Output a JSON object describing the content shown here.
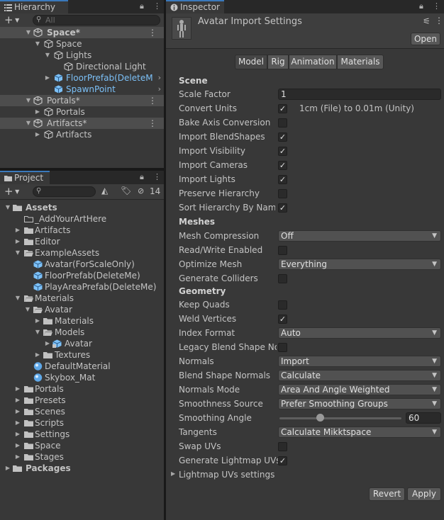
{
  "hierarchy": {
    "title": "Hierarchy",
    "search_placeholder": "All",
    "rows": [
      {
        "label": "Space*",
        "indent": 0
      },
      {
        "label": "Space",
        "indent": 1
      },
      {
        "label": "Lights",
        "indent": 2
      },
      {
        "label": "Directional Light",
        "indent": 3
      },
      {
        "label": "FloorPrefab(DeleteMe)",
        "indent": 2
      },
      {
        "label": "SpawnPoint",
        "indent": 2
      },
      {
        "label": "Portals*",
        "indent": 0
      },
      {
        "label": "Portals",
        "indent": 1
      },
      {
        "label": "Artifacts*",
        "indent": 0
      },
      {
        "label": "Artifacts",
        "indent": 1
      }
    ]
  },
  "project": {
    "title": "Project",
    "search_placeholder": "",
    "hidden_count": "14",
    "rows": [
      {
        "label": "Assets"
      },
      {
        "label": "_AddYourArtHere"
      },
      {
        "label": "Artifacts"
      },
      {
        "label": "Editor"
      },
      {
        "label": "ExampleAssets"
      },
      {
        "label": "Avatar(ForScaleOnly)"
      },
      {
        "label": "FloorPrefab(DeleteMe)"
      },
      {
        "label": "PlayAreaPrefab(DeleteMe)"
      },
      {
        "label": "Materials"
      },
      {
        "label": "Avatar"
      },
      {
        "label": "Materials"
      },
      {
        "label": "Models"
      },
      {
        "label": "Avatar"
      },
      {
        "label": "Textures"
      },
      {
        "label": "DefaultMaterial"
      },
      {
        "label": "Skybox_Mat"
      },
      {
        "label": "Portals"
      },
      {
        "label": "Presets"
      },
      {
        "label": "Scenes"
      },
      {
        "label": "Scripts"
      },
      {
        "label": "Settings"
      },
      {
        "label": "Space"
      },
      {
        "label": "Stages"
      },
      {
        "label": "Packages"
      }
    ]
  },
  "inspector": {
    "title": "Inspector",
    "header_title": "Avatar Import Settings",
    "open_label": "Open",
    "tabs": [
      "Model",
      "Rig",
      "Animation",
      "Materials"
    ],
    "sections": {
      "scene": "Scene",
      "meshes": "Meshes",
      "geometry": "Geometry"
    },
    "labels": {
      "scale_factor": "Scale Factor",
      "convert_units": "Convert Units",
      "bake_axis": "Bake Axis Conversion",
      "import_blendshapes": "Import BlendShapes",
      "import_visibility": "Import Visibility",
      "import_cameras": "Import Cameras",
      "import_lights": "Import Lights",
      "preserve_hierarchy": "Preserve Hierarchy",
      "sort_hierarchy": "Sort Hierarchy By Name",
      "mesh_compression": "Mesh Compression",
      "read_write": "Read/Write Enabled",
      "optimize_mesh": "Optimize Mesh",
      "generate_colliders": "Generate Colliders",
      "keep_quads": "Keep Quads",
      "weld_vertices": "Weld Vertices",
      "index_format": "Index Format",
      "legacy_blend": "Legacy Blend Shape Normals",
      "normals": "Normals",
      "blend_shape_normals": "Blend Shape Normals",
      "normals_mode": "Normals Mode",
      "smoothness_source": "Smoothness Source",
      "smoothing_angle": "Smoothing Angle",
      "tangents": "Tangents",
      "swap_uvs": "Swap UVs",
      "generate_lightmap_uvs": "Generate Lightmap UVs",
      "lightmap_uvs_settings": "Lightmap UVs settings"
    },
    "values": {
      "scale_factor": "1",
      "convert_units_note": "1cm (File) to 0.01m (Unity)",
      "mesh_compression": "Off",
      "optimize_mesh": "Everything",
      "index_format": "Auto",
      "normals": "Import",
      "blend_shape_normals": "Calculate",
      "normals_mode": "Area And Angle Weighted",
      "smoothness_source": "Prefer Smoothing Groups",
      "smoothing_angle": "60",
      "smoothing_angle_fraction": 0.333,
      "tangents": "Calculate Mikktspace"
    },
    "checks": {
      "convert_units": true,
      "bake_axis": false,
      "import_blendshapes": true,
      "import_visibility": true,
      "import_cameras": true,
      "import_lights": true,
      "preserve_hierarchy": false,
      "sort_hierarchy": true,
      "read_write": false,
      "generate_colliders": false,
      "keep_quads": false,
      "weld_vertices": true,
      "legacy_blend": false,
      "swap_uvs": false,
      "generate_lightmap_uvs": true
    },
    "revert_label": "Revert",
    "apply_label": "Apply"
  },
  "colors": {
    "accent": "#3a79bb",
    "prefab_blue": "#7cc0f7",
    "panel": "#383838"
  }
}
